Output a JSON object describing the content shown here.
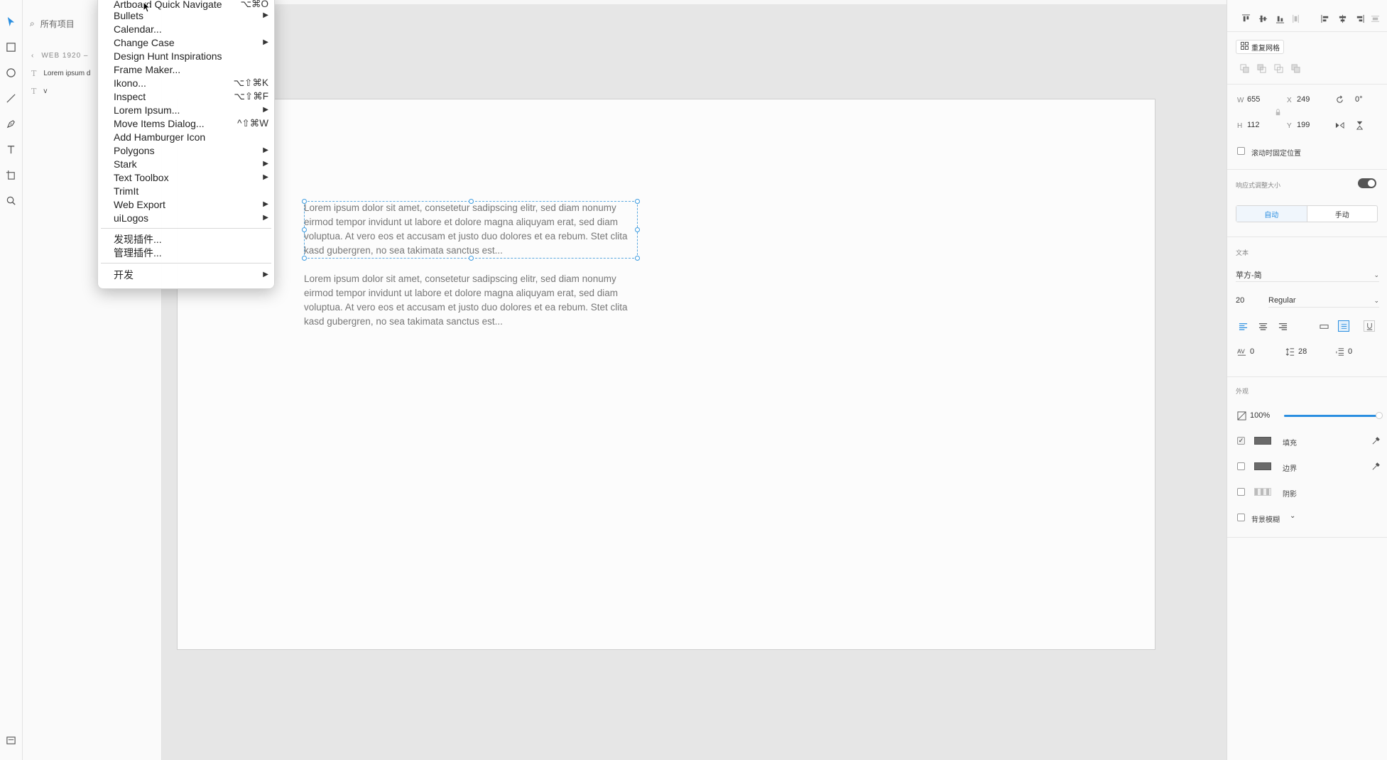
{
  "layers": {
    "search_placeholder": "所有项目",
    "breadcrumb": "WEB 1920 –",
    "rows": [
      {
        "label": "Lorem ipsum d"
      },
      {
        "label": "v"
      }
    ]
  },
  "canvas": {
    "paragraph_1": "Lorem ipsum dolor sit amet, consetetur sadipscing elitr, sed diam nonumy eirmod tempor invidunt ut labore et dolore magna aliquyam erat, sed diam voluptua. At vero eos et accusam et justo duo dolores et ea rebum. Stet clita kasd gubergren, no sea takimata sanctus est...",
    "paragraph_2": "Lorem ipsum dolor sit amet, consetetur sadipscing elitr, sed diam nonumy eirmod tempor invidunt ut labore et dolore magna aliquyam erat, sed diam voluptua. At vero eos et accusam et justo duo dolores et ea rebum. Stet clita kasd gubergren, no sea takimata sanctus est..."
  },
  "menu": {
    "items": [
      {
        "label": "Artboard Quick Navigate",
        "shortcut": "⌥⌘O",
        "submenu": false
      },
      {
        "label": "Bullets",
        "shortcut": "",
        "submenu": true
      },
      {
        "label": "Calendar...",
        "shortcut": "",
        "submenu": false
      },
      {
        "label": "Change Case",
        "shortcut": "",
        "submenu": true
      },
      {
        "label": "Design Hunt Inspirations",
        "shortcut": "",
        "submenu": false
      },
      {
        "label": "Frame Maker...",
        "shortcut": "",
        "submenu": false
      },
      {
        "label": "Ikono...",
        "shortcut": "⌥⇧⌘K",
        "submenu": false
      },
      {
        "label": "Inspect",
        "shortcut": "⌥⇧⌘F",
        "submenu": false
      },
      {
        "label": "Lorem Ipsum...",
        "shortcut": "",
        "submenu": true
      },
      {
        "label": "Move Items Dialog...",
        "shortcut": "^⇧⌘W",
        "submenu": false
      },
      {
        "label": "Add Hamburger Icon",
        "shortcut": "",
        "submenu": false
      },
      {
        "label": "Polygons",
        "shortcut": "",
        "submenu": true
      },
      {
        "label": "Stark",
        "shortcut": "",
        "submenu": true
      },
      {
        "label": "Text Toolbox",
        "shortcut": "",
        "submenu": true
      },
      {
        "label": "TrimIt",
        "shortcut": "",
        "submenu": false
      },
      {
        "label": "Web Export",
        "shortcut": "",
        "submenu": true
      },
      {
        "label": "uiLogos",
        "shortcut": "",
        "submenu": true
      }
    ],
    "plugins": [
      {
        "label": "发现插件..."
      },
      {
        "label": "管理插件..."
      }
    ],
    "develop": {
      "label": "开发",
      "submenu": true
    },
    "arrow_glyph": "▶"
  },
  "inspector": {
    "repeat_grid": "重复网格",
    "w_label": "W",
    "w_value": "655",
    "x_label": "X",
    "x_value": "249",
    "rotation": "0°",
    "h_label": "H",
    "h_value": "112",
    "y_label": "Y",
    "y_value": "199",
    "fix_position": "滚动时固定位置",
    "responsive_resize": "响应式调整大小",
    "auto": "自动",
    "manual": "手动",
    "text_section": "文本",
    "font_family": "苹方-简",
    "font_size": "20",
    "font_weight": "Regular",
    "char_spacing": "0",
    "line_spacing": "28",
    "para_spacing": "0",
    "appearance_section": "外观",
    "opacity": "100%",
    "opacity_level": 1.0,
    "fill": "填充",
    "border": "边界",
    "shadow": "阴影",
    "bg_blur": "背景模糊",
    "accent_color": "#2a8ee0"
  }
}
